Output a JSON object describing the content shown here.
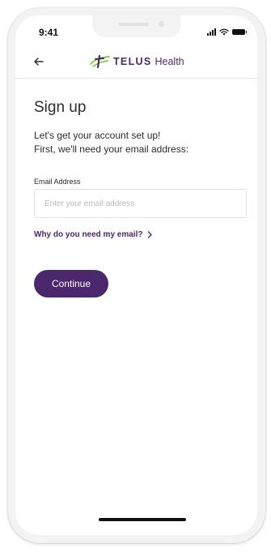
{
  "status_bar": {
    "time": "9:41",
    "icons": [
      "signal-icon",
      "wifi-icon",
      "battery-icon"
    ]
  },
  "header": {
    "back_icon": "arrow-left-icon",
    "brand_name": "TELUS",
    "brand_suffix": "Health",
    "brand_color": "#4b286d",
    "brand_mark_color": "#66cc00"
  },
  "main": {
    "title": "Sign up",
    "intro_line1": "Let's get your account set up!",
    "intro_line2": "First, we'll need your email address:",
    "email_label": "Email Address",
    "email_value": "",
    "email_placeholder": "Enter your email address",
    "why_link": "Why do you need my email?",
    "why_link_icon": "chevron-right-icon",
    "continue_label": "Continue"
  }
}
